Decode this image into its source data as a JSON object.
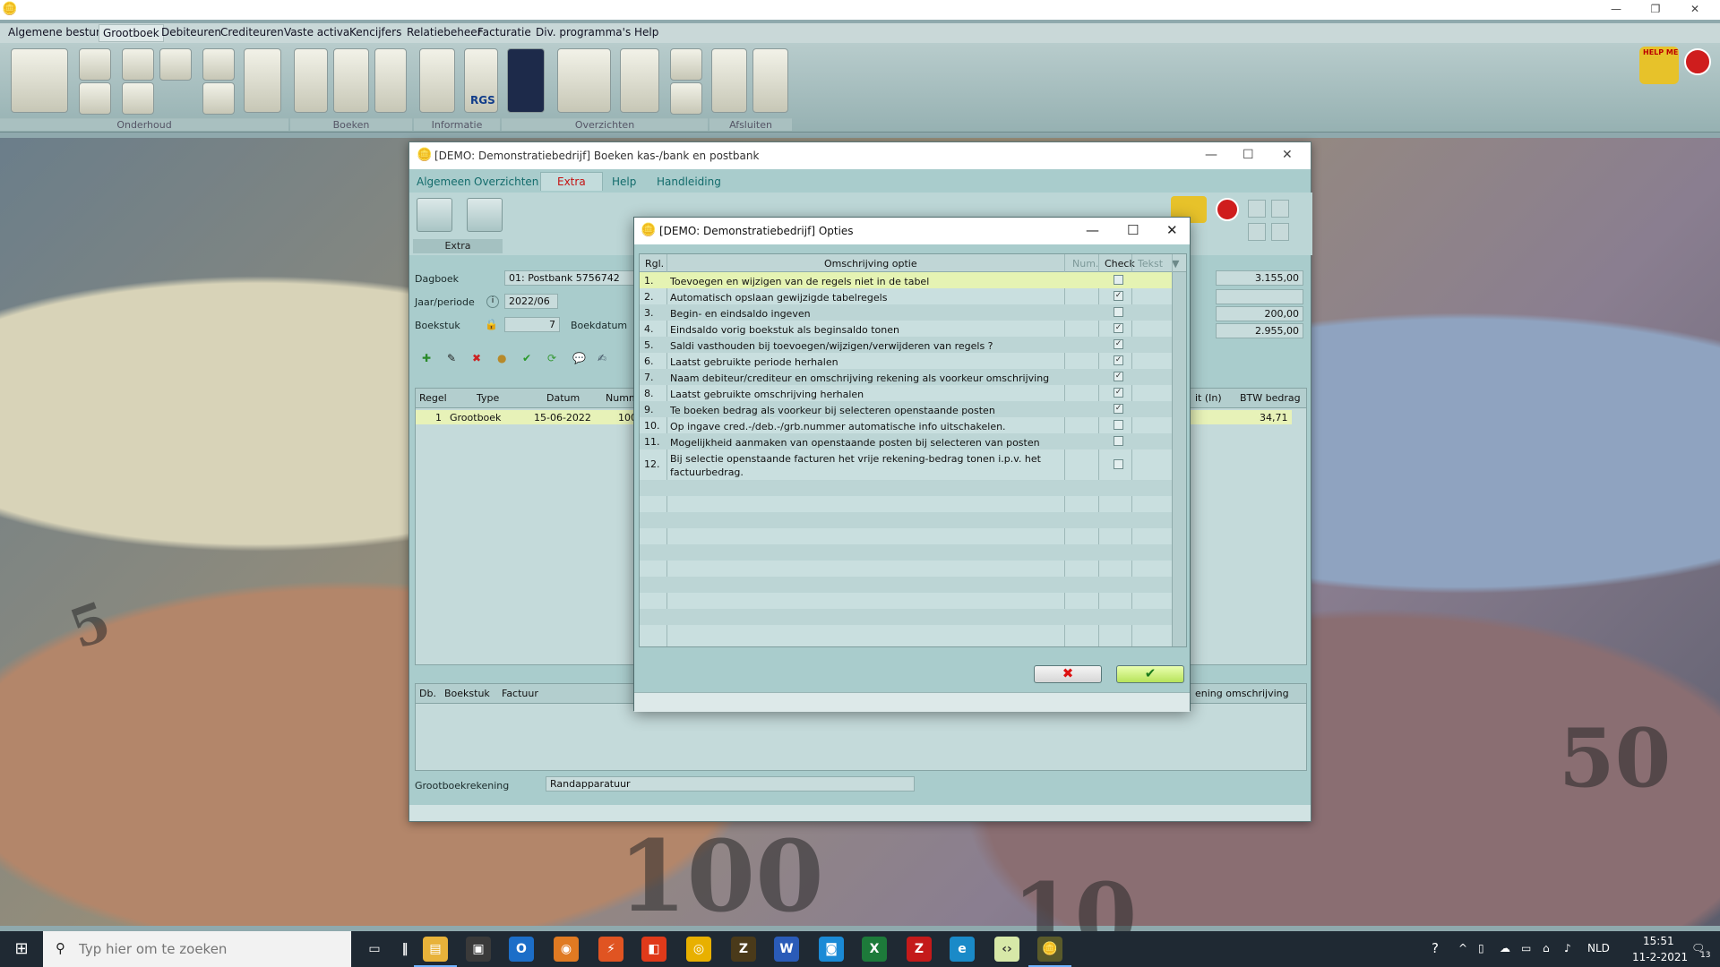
{
  "app": {
    "menu": [
      "Algemene besturing",
      "Grootboek",
      "Debiteuren",
      "Crediteuren",
      "Vaste activa",
      "Kencijfers",
      "Relatiebeheer",
      "Facturatie",
      "Div. programma's",
      "Help"
    ],
    "ribbon_groups": [
      "Onderhoud",
      "Boeken",
      "Informatie",
      "Overzichten",
      "Afsluiten"
    ],
    "rgs_label": "RGS",
    "help_label": "HELP ME"
  },
  "window": {
    "title": "[DEMO: Demonstratiebedrijf]  Boeken kas-/bank en postbank",
    "tabs": [
      "Algemeen",
      "Overzichten",
      "Extra",
      "Help",
      "Handleiding"
    ],
    "extra_label": "Extra",
    "fields": {
      "dagboek_label": "Dagboek",
      "dagboek_value": "01: Postbank 5756742",
      "periode_label": "Jaar/periode",
      "periode_value": "2022/06",
      "boekstuk_label": "Boekstuk",
      "boekstuk_value": "7",
      "boekdatum_label": "Boekdatum",
      "amount1": "3.155,00",
      "amount2": "",
      "amount3": "200,00",
      "amount4": "2.955,00"
    },
    "grid": {
      "headers": [
        "Regel",
        "Type",
        "Datum",
        "Numme",
        "it (In)",
        "BTW bedrag"
      ],
      "row": [
        "1",
        "Grootboek",
        "15-06-2022",
        "1002",
        "34,71"
      ]
    },
    "lower_grid": {
      "headers": [
        "Db.",
        "Boekstuk",
        "Factuur",
        "ening omschrijving"
      ]
    },
    "grootboek_label": "Grootboekrekening",
    "grootboek_value": "Randapparatuur"
  },
  "dialog": {
    "title": "[DEMO: Demonstratiebedrijf]  Opties",
    "headers": {
      "rgl": "Rgl.",
      "omschrijving": "Omschrijving optie",
      "num": "Num.",
      "check": "Check",
      "tekst": "Tekst"
    },
    "rows": [
      {
        "n": "1.",
        "text": "Toevoegen en wijzigen van de regels niet in de tabel",
        "checked": false
      },
      {
        "n": "2.",
        "text": "Automatisch opslaan gewijzigde tabelregels",
        "checked": true
      },
      {
        "n": "3.",
        "text": "Begin- en eindsaldo ingeven",
        "checked": false
      },
      {
        "n": "4.",
        "text": "Eindsaldo vorig boekstuk als beginsaldo tonen",
        "checked": true
      },
      {
        "n": "5.",
        "text": "Saldi vasthouden bij toevoegen/wijzigen/verwijderen van regels ?",
        "checked": true
      },
      {
        "n": "6.",
        "text": "Laatst gebruikte periode herhalen",
        "checked": true
      },
      {
        "n": "7.",
        "text": "Naam debiteur/crediteur en omschrijving rekening als voorkeur omschrijving",
        "checked": true
      },
      {
        "n": "8.",
        "text": "Laatst gebruikte omschrijving herhalen",
        "checked": true
      },
      {
        "n": "9.",
        "text": "Te boeken bedrag als voorkeur bij selecteren openstaande posten",
        "checked": true
      },
      {
        "n": "10.",
        "text": "Op ingave cred.-/deb.-/grb.nummer automatische info uitschakelen.",
        "checked": false
      },
      {
        "n": "11.",
        "text": "Mogelijkheid aanmaken van openstaande posten bij selecteren van posten",
        "checked": false
      },
      {
        "n": "12.",
        "text": "Bij selectie openstaande facturen het vrije rekening-bedrag tonen i.p.v. het factuurbedrag.",
        "checked": false
      }
    ],
    "cancel_glyph": "✖",
    "ok_glyph": "✔"
  },
  "taskbar": {
    "search_placeholder": "Typ hier om te zoeken",
    "lang": "NLD",
    "time": "15:51",
    "date": "11-2-2021",
    "notif_count": "13"
  },
  "colors": {
    "accent": "#c41212",
    "teal": "#a9cccc",
    "selection": "#e5f3b3"
  }
}
